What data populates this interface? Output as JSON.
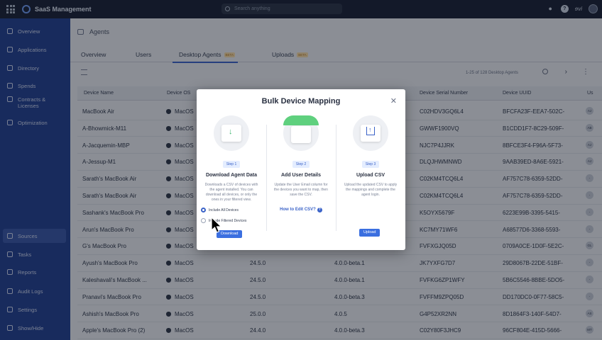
{
  "app": {
    "title": "SaaS Management",
    "search_placeholder": "Search anything"
  },
  "sidebar": {
    "items": [
      {
        "label": "Overview",
        "icon": "overview-icon"
      },
      {
        "label": "Applications",
        "icon": "applications-icon"
      },
      {
        "label": "Directory",
        "icon": "directory-icon"
      },
      {
        "label": "Spends",
        "icon": "spends-icon"
      },
      {
        "label_line1": "Contracts &",
        "label_line2": "Licenses",
        "icon": "contracts-icon"
      },
      {
        "label": "Optimization",
        "icon": "optimization-icon"
      },
      {
        "label": "Sources",
        "icon": "sources-icon"
      },
      {
        "label": "Tasks",
        "icon": "tasks-icon"
      },
      {
        "label": "Reports",
        "icon": "reports-icon"
      },
      {
        "label": "Audit Logs",
        "icon": "audit-logs-icon"
      },
      {
        "label": "Settings",
        "icon": "settings-icon"
      },
      {
        "label": "Show/Hide",
        "icon": "show-hide-icon"
      }
    ]
  },
  "page": {
    "title": "Agents",
    "tabs": [
      "Overview",
      "Users",
      "Desktop Agents",
      "Uploads"
    ],
    "tab_badges": {
      "desktop_agents": "BETA",
      "uploads": "BETA"
    },
    "pagination": "1-25 of 128 Desktop Agents"
  },
  "table": {
    "columns": [
      "Device Name",
      "Device OS",
      "Device Serial Number",
      "Device UUID",
      "Us"
    ],
    "rows": [
      {
        "name": "MacBook Air",
        "os": "MacOS",
        "version": "",
        "agent": "",
        "serial": "C02HDV3GQ6L4",
        "uuid": "BFCFA23F-EEA7-502C-",
        "user": "AJ"
      },
      {
        "name": "A-Bhowmick-M11",
        "os": "MacOS",
        "version": "",
        "agent": "",
        "serial": "GWWF1900VQ",
        "uuid": "B1CDD1F7-8C29-509F-",
        "user": "AB"
      },
      {
        "name": "A-Jacquemin-MBP",
        "os": "MacOS",
        "version": "",
        "agent": "",
        "serial": "NJC7P4JJRK",
        "uuid": "8BFCE3F4-F96A-5F73-",
        "user": "AJ"
      },
      {
        "name": "A-Jessup-M1",
        "os": "MacOS",
        "version": "",
        "agent": "",
        "serial": "DLQJHWMNWD",
        "uuid": "9AAB39ED-8A6E-5921-",
        "user": "AJ"
      },
      {
        "name": "Sarath's MacBook Air",
        "os": "MacOS",
        "version": "",
        "agent": "",
        "serial": "C02KM4TCQ6L4",
        "uuid": "AF757C78-6359-52DD-",
        "user": "-"
      },
      {
        "name": "Sarath's MacBook Air",
        "os": "MacOS",
        "version": "",
        "agent": "",
        "serial": "C02KM4TCQ6L4",
        "uuid": "AF757C78-6359-52DD-",
        "user": "-"
      },
      {
        "name": "Sashank's MacBook Pro",
        "os": "MacOS",
        "version": "",
        "agent": "",
        "serial": "K5OYX5679F",
        "uuid": "6223E99B-3395-5415-",
        "user": "-"
      },
      {
        "name": "Arun's MacBook Pro",
        "os": "MacOS",
        "version": "",
        "agent": "",
        "serial": "KC7MY71WF6",
        "uuid": "A68577D6-3368-5593-",
        "user": "-"
      },
      {
        "name": "G's MacBook Pro",
        "os": "MacOS",
        "version": "",
        "agent": "",
        "serial": "FVFXGJQ05D",
        "uuid": "0709A0CE-1D0F-5E2C-",
        "user": "GL"
      },
      {
        "name": "Ayush's MacBook Pro",
        "os": "MacOS",
        "version": "24.5.0",
        "agent": "4.0.0-beta.1",
        "serial": "JK7YXFG7D7",
        "uuid": "29D8067B-22DE-51BF-",
        "user": "-"
      },
      {
        "name": "Kaleshavali's MacBook ...",
        "os": "MacOS",
        "version": "24.5.0",
        "agent": "4.0.0-beta.1",
        "serial": "FVFKG6ZP1WFY",
        "uuid": "5B6C5546-8BBE-5DO5-",
        "user": "-"
      },
      {
        "name": "Pranavi's MacBook Pro",
        "os": "MacOS",
        "version": "24.5.0",
        "agent": "4.0.0-beta.3",
        "serial": "FVFFM9ZPQ05D",
        "uuid": "DD170DC0-0F77-58C5-",
        "user": "-"
      },
      {
        "name": "Ashish's MacBook Pro",
        "os": "MacOS",
        "version": "25.0.0",
        "agent": "4.0.5",
        "serial": "G4P52XR2NN",
        "uuid": "8D1864F3-140F-54D7-",
        "user": "AS"
      },
      {
        "name": "Apple's MacBook Pro (2)",
        "os": "MacOS",
        "version": "24.4.0",
        "agent": "4.0.0-beta.3",
        "serial": "C02Y80F3JHC9",
        "uuid": "96CF804E-415D-5666-",
        "user": "MT"
      }
    ]
  },
  "modal": {
    "title": "Bulk Device Mapping",
    "steps": [
      {
        "label": "Step 1",
        "title": "Download Agent Data",
        "desc": "Downloads a CSV of devices with the agent installed. You can download all devices, or only the ones in your filtered view.",
        "options": [
          "Include All Devices",
          "Include Filtered Devices"
        ],
        "button": "Download"
      },
      {
        "label": "Step 2",
        "title": "Add User Details",
        "desc": "Update the User Email column for the devices you want to map, then save the CSV.",
        "link": "How to Edit CSV?"
      },
      {
        "label": "Step 3",
        "title": "Upload CSV",
        "desc": "Upload the updated CSV to apply the mappings and complete the agent login.",
        "button": "Upload"
      }
    ]
  },
  "colors": {
    "sidebar": "#24418f",
    "accent": "#3b6fe0",
    "topbar": "#1a2236"
  }
}
